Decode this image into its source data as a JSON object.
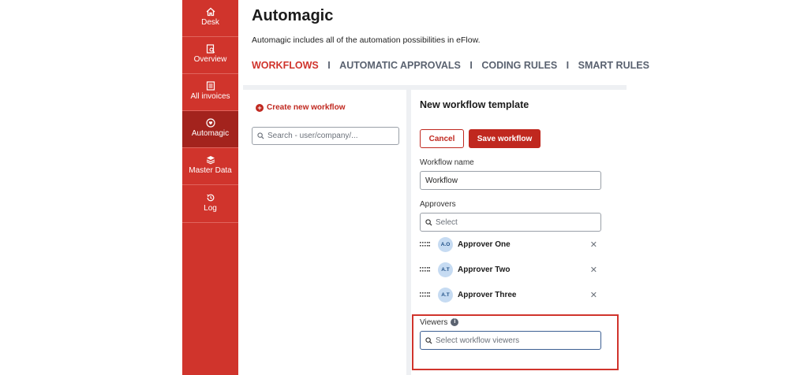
{
  "sidebar": {
    "items": [
      {
        "label": "Desk",
        "icon": "home-icon"
      },
      {
        "label": "Overview",
        "icon": "overview-icon"
      },
      {
        "label": "All invoices",
        "icon": "invoices-icon"
      },
      {
        "label": "Automagic",
        "icon": "automagic-icon",
        "active": true
      },
      {
        "label": "Master Data",
        "icon": "layers-icon"
      },
      {
        "label": "Log",
        "icon": "history-icon"
      }
    ]
  },
  "header": {
    "title": "Automagic",
    "subtitle": "Automagic includes all of the automation possibilities in eFlow.",
    "tabs": [
      "WORKFLOWS",
      "AUTOMATIC APPROVALS",
      "CODING RULES",
      "SMART RULES"
    ],
    "separator": "I"
  },
  "left_panel": {
    "create_label": "Create new workflow",
    "search_placeholder": "Search - user/company/..."
  },
  "right_panel": {
    "title": "New workflow template",
    "cancel_label": "Cancel",
    "save_label": "Save workflow",
    "workflow_name_label": "Workflow name",
    "workflow_name_value": "Workflow",
    "approvers_label": "Approvers",
    "approvers_placeholder": "Select",
    "approvers": [
      {
        "initials": "A.O",
        "name": "Approver One"
      },
      {
        "initials": "A.T",
        "name": "Approver Two"
      },
      {
        "initials": "A.T",
        "name": "Approver Three"
      }
    ],
    "remove_glyph": "✕",
    "viewers_label": "Viewers",
    "info_glyph": "i",
    "viewers_placeholder": "Select workflow viewers"
  },
  "colors": {
    "brand_red": "#d0342c",
    "active_nav": "#a3231d",
    "avatar_bg": "#c6dbf2"
  }
}
